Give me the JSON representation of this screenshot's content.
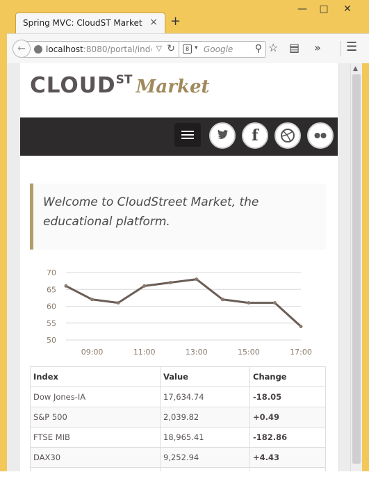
{
  "browser": {
    "tab_title": "Spring MVC: CloudST Market",
    "tab_close": "×",
    "new_tab": "+",
    "window_controls": {
      "minimize": "—",
      "maximize": "□",
      "close": "✕"
    },
    "url_host": "localhost",
    "url_rest": ":8080/portal/inde",
    "search_placeholder": "Google",
    "icons": [
      "back-icon",
      "site-info-icon",
      "reload-icon",
      "search-engine-icon",
      "bookmark-star-icon",
      "reading-list-icon",
      "overflow-icon",
      "menu-icon"
    ]
  },
  "site": {
    "logo_cloud": "CLOUD",
    "logo_st": "ST",
    "logo_market": "Market",
    "colors": {
      "nav_bg": "#2d2b2b",
      "accent": "#b29c6e",
      "line": "#6a5d56"
    },
    "social": [
      "twitter-icon",
      "facebook-icon",
      "dribbble-icon",
      "flickr-icon"
    ],
    "welcome": "Welcome to CloudStreet Market, the educational platform."
  },
  "chart_data": {
    "type": "line",
    "x": [
      "08:00",
      "09:00",
      "10:00",
      "11:00",
      "12:00",
      "13:00",
      "14:00",
      "15:00",
      "16:00",
      "17:00"
    ],
    "x_tick_labels": [
      "09:00",
      "11:00",
      "13:00",
      "15:00",
      "17:00"
    ],
    "values": [
      66,
      62,
      61,
      66,
      67,
      68,
      62,
      61,
      61,
      54
    ],
    "y_ticks": [
      70,
      65,
      60,
      55,
      50
    ],
    "ylim": [
      50,
      70
    ],
    "grid": true,
    "line_color": "#6a5d56"
  },
  "table": {
    "headers": [
      "Index",
      "Value",
      "Change"
    ],
    "rows": [
      [
        "Dow Jones-IA",
        "17,634.74",
        "-18.05"
      ],
      [
        "S&P 500",
        "2,039.82",
        "+0.49"
      ],
      [
        "FTSE MIB",
        "18,965.41",
        "-182.86"
      ],
      [
        "DAX30",
        "9,252.94",
        "+4.43"
      ]
    ]
  }
}
